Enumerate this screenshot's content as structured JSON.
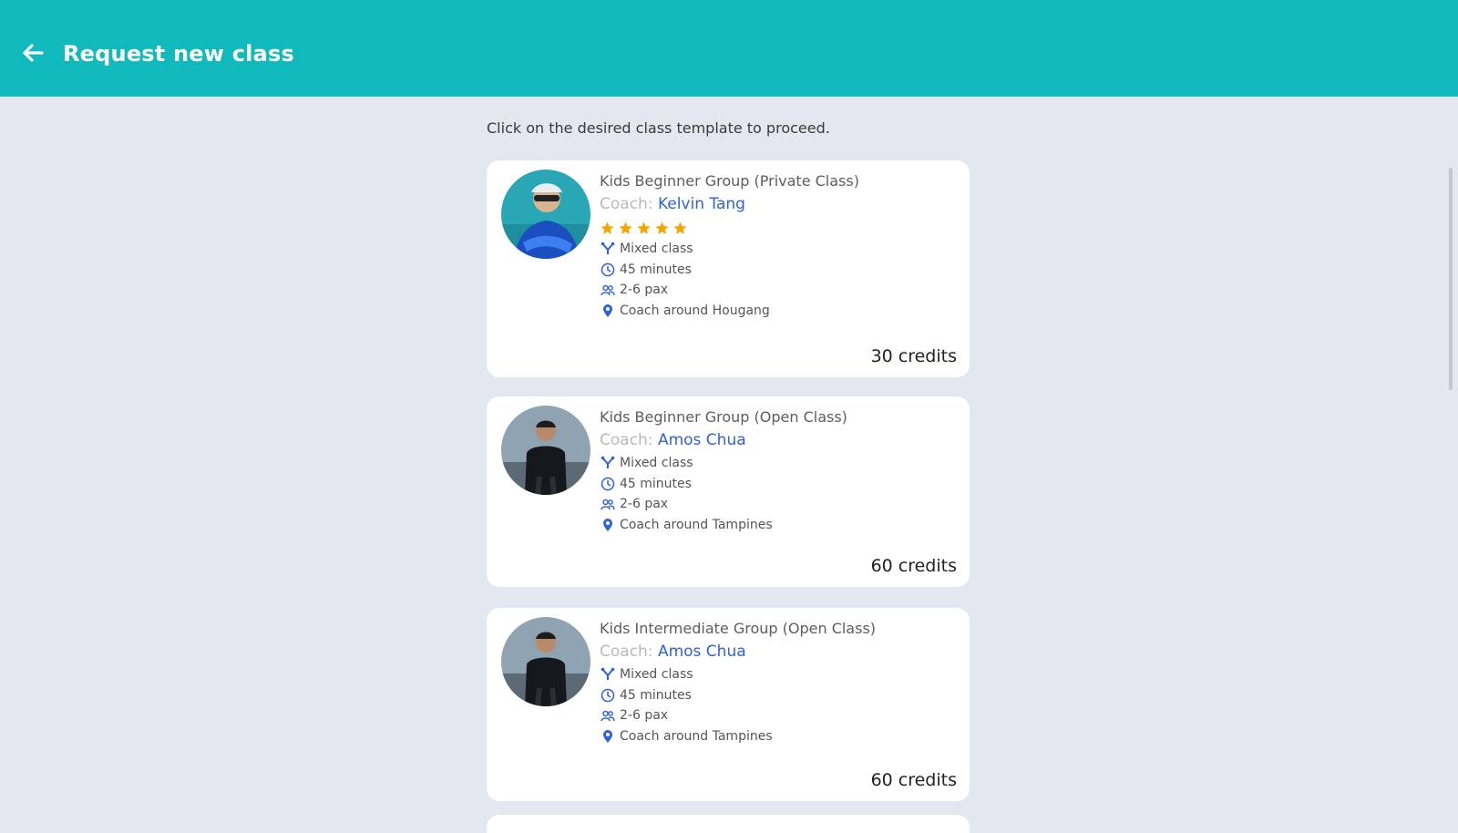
{
  "header": {
    "title": "Request new class",
    "back_icon": "arrow-left-icon",
    "bg_color": "#10b9bb"
  },
  "instructions": "Click on the desired class template to proceed.",
  "coach_label": "Coach:",
  "colors": {
    "accent": "#2f5fe3",
    "star": "#f7a400",
    "background": "#e3e8f0"
  },
  "cards": [
    {
      "title": "Kids Beginner Group (Private Class)",
      "coach": "Kelvin  Tang",
      "rating": 5,
      "features": [
        {
          "icon": "mixed-class-icon",
          "text": "Mixed class"
        },
        {
          "icon": "clock-icon",
          "text": "45 minutes"
        },
        {
          "icon": "people-icon",
          "text": "2-6 pax"
        },
        {
          "icon": "location-pin-icon",
          "text": "Coach around Hougang"
        }
      ],
      "credits": "30 credits"
    },
    {
      "title": "Kids Beginner Group (Open Class)",
      "coach": "Amos  Chua",
      "rating": 0,
      "features": [
        {
          "icon": "mixed-class-icon",
          "text": "Mixed class"
        },
        {
          "icon": "clock-icon",
          "text": "45 minutes"
        },
        {
          "icon": "people-icon",
          "text": "2-6 pax"
        },
        {
          "icon": "location-pin-icon",
          "text": "Coach around Tampines"
        }
      ],
      "credits": "60 credits"
    },
    {
      "title": "Kids Intermediate Group (Open Class)",
      "coach": "Amos  Chua",
      "rating": 0,
      "features": [
        {
          "icon": "mixed-class-icon",
          "text": "Mixed class"
        },
        {
          "icon": "clock-icon",
          "text": "45 minutes"
        },
        {
          "icon": "people-icon",
          "text": "2-6 pax"
        },
        {
          "icon": "location-pin-icon",
          "text": "Coach around Tampines"
        }
      ],
      "credits": "60 credits"
    }
  ]
}
